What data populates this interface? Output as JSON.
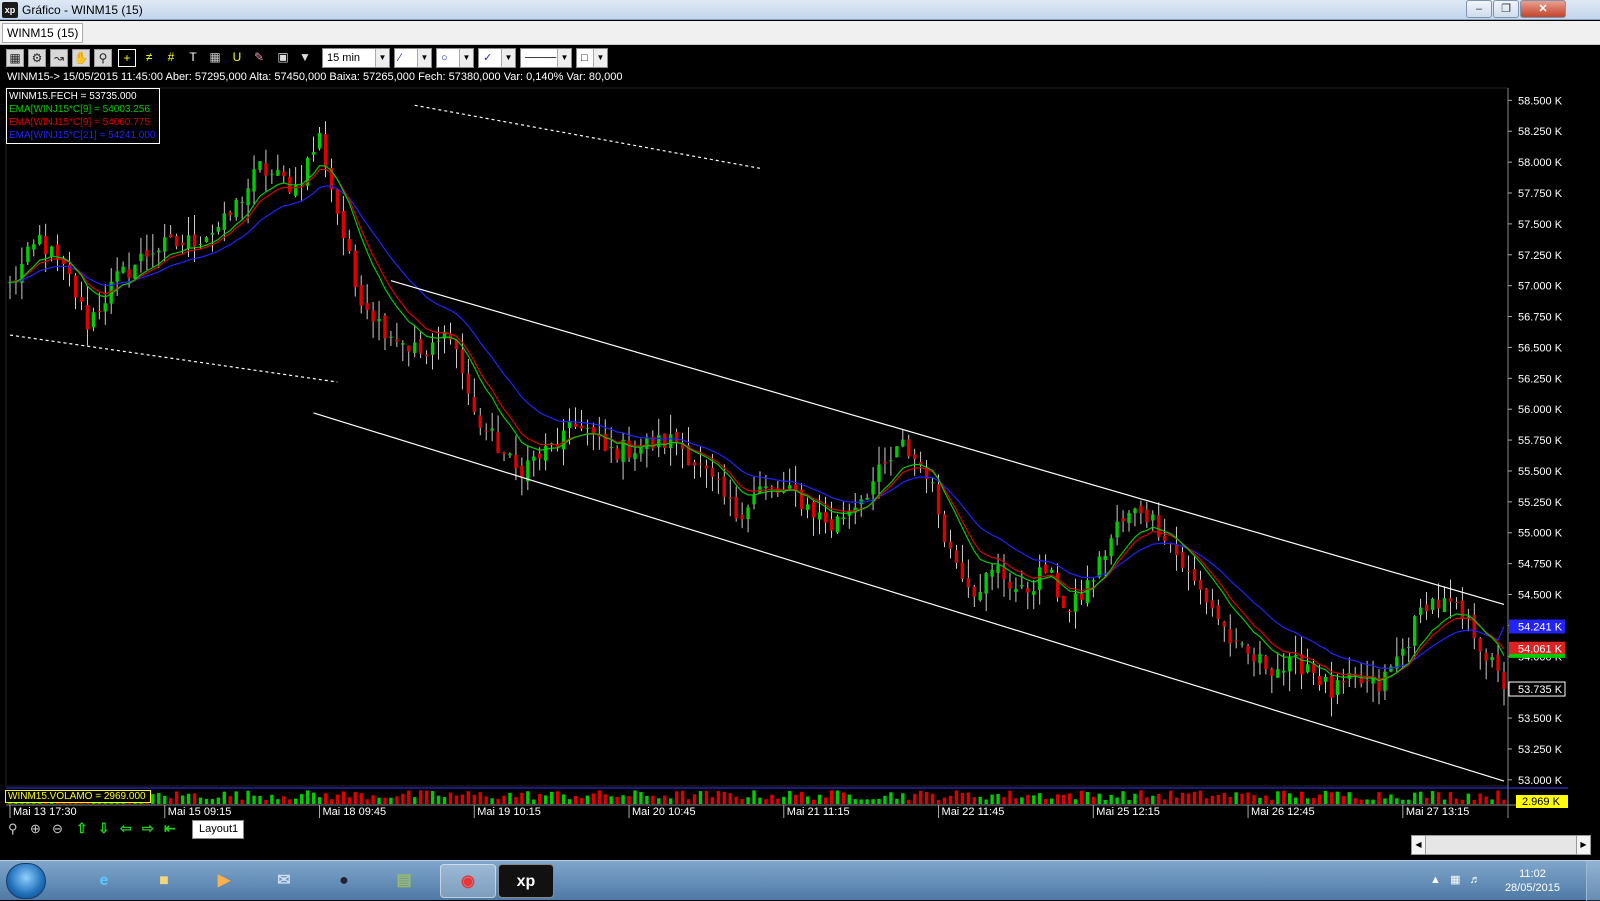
{
  "window": {
    "title": "Gráfico - WINM15 (15)",
    "app_icon": "xp",
    "buttons": [
      "minimize-icon",
      "maximize-icon",
      "close-icon"
    ]
  },
  "tab": {
    "label": "WINM15 (15)"
  },
  "toolbar": {
    "icons": [
      "chart-icon",
      "gear-icon",
      "indicator-icon",
      "hand-icon",
      "zoom-area-icon",
      "crosshair-icon",
      "fibonacci-icon",
      "grid-icon",
      "text-icon",
      "calculator-icon",
      "magnet-icon",
      "eraser-icon",
      "lock-icon",
      "filter-icon"
    ],
    "period": "15 min",
    "line_tool": "line-icon",
    "shape_tool": "circle-icon",
    "pen_tool": "pen-icon",
    "line_style": "solid-line-icon",
    "color_tool": "color-box-icon"
  },
  "info_line": "WINM15-> 15/05/2015 11:45:00 Aber: 57295,000 Alta: 57450,000 Baixa: 57265,000 Fech: 57380,000 Var: 0,140% Var: 80,000",
  "legend": {
    "items": [
      {
        "text": "WINM15.FECH = 53735.000",
        "color": "#ffffff"
      },
      {
        "text": "EMA[WINJ15*C[9] = 54003.256",
        "color": "#00cc00"
      },
      {
        "text": "EMA[WINJ15*C[9] = 54060.775",
        "color": "#dd0000"
      },
      {
        "text": "EMA[WINJ15*C[21] = 54241.000",
        "color": "#2222ff"
      }
    ]
  },
  "volume_legend": "WINM15.VOLAMO = 2969.000",
  "chart_data": {
    "type": "candlestick",
    "instrument": "WINM15",
    "interval": "15 min",
    "y_range": [
      52950,
      58600
    ],
    "y_ticks": [
      "58.500 K",
      "58.250 K",
      "58.000 K",
      "57.750 K",
      "57.500 K",
      "57.250 K",
      "57.000 K",
      "56.750 K",
      "56.500 K",
      "56.250 K",
      "56.000 K",
      "55.750 K",
      "55.500 K",
      "55.250 K",
      "55.000 K",
      "54.750 K",
      "54.500 K",
      "54.250 K",
      "54.000 K",
      "53.750 K",
      "53.500 K",
      "53.250 K",
      "53.000 K"
    ],
    "y_tick_values": [
      58500,
      58250,
      58000,
      57750,
      57500,
      57250,
      57000,
      56750,
      56500,
      56250,
      56000,
      55750,
      55500,
      55250,
      55000,
      54750,
      54500,
      54250,
      54000,
      53750,
      53500,
      53250,
      53000
    ],
    "x_labels": [
      "Mai 13 17:30",
      "Mai 15 09:15",
      "Mai 18 09:45",
      "Mai 19 10:15",
      "Mai 20 10:45",
      "Mai 21 11:15",
      "Mai 22 11:45",
      "Mai 25 12:15",
      "Mai 26 12:45",
      "Mai 27 13:15"
    ],
    "x_label_bars": [
      0,
      26,
      52,
      78,
      104,
      130,
      156,
      182,
      208,
      234
    ],
    "bar_count": 252,
    "close_path": [
      [
        0,
        57000
      ],
      [
        5,
        57380
      ],
      [
        10,
        57050
      ],
      [
        13,
        56700
      ],
      [
        18,
        57050
      ],
      [
        24,
        57300
      ],
      [
        30,
        57350
      ],
      [
        36,
        57500
      ],
      [
        42,
        57950
      ],
      [
        48,
        57800
      ],
      [
        52,
        58200
      ],
      [
        55,
        57600
      ],
      [
        58,
        57000
      ],
      [
        62,
        56700
      ],
      [
        66,
        56550
      ],
      [
        70,
        56420
      ],
      [
        74,
        56650
      ],
      [
        78,
        55950
      ],
      [
        82,
        55700
      ],
      [
        85,
        55500
      ],
      [
        90,
        55650
      ],
      [
        96,
        55900
      ],
      [
        100,
        55650
      ],
      [
        106,
        55700
      ],
      [
        112,
        55750
      ],
      [
        118,
        55400
      ],
      [
        122,
        55150
      ],
      [
        126,
        55350
      ],
      [
        132,
        55300
      ],
      [
        138,
        55050
      ],
      [
        144,
        55350
      ],
      [
        150,
        55700
      ],
      [
        154,
        55500
      ],
      [
        158,
        54850
      ],
      [
        162,
        54550
      ],
      [
        166,
        54700
      ],
      [
        170,
        54500
      ],
      [
        174,
        54700
      ],
      [
        178,
        54350
      ],
      [
        182,
        54650
      ],
      [
        186,
        55050
      ],
      [
        190,
        55200
      ],
      [
        194,
        55000
      ],
      [
        198,
        54650
      ],
      [
        202,
        54400
      ],
      [
        206,
        54050
      ],
      [
        210,
        53950
      ],
      [
        214,
        53900
      ],
      [
        218,
        53950
      ],
      [
        222,
        53700
      ],
      [
        226,
        53800
      ],
      [
        230,
        53750
      ],
      [
        234,
        54050
      ],
      [
        238,
        54450
      ],
      [
        242,
        54400
      ],
      [
        246,
        54200
      ],
      [
        251,
        53735
      ]
    ],
    "ema9_last": 54003.256,
    "ema9b_last": 54060.775,
    "ema21_last": 54241.0,
    "last_close": 53735,
    "last_volume": 2969,
    "price_tags": [
      {
        "text": "54.241 K",
        "value": 54241,
        "color": "#2222ff"
      },
      {
        "text": "54.061 K",
        "value": 54061,
        "color": "#dd2222"
      },
      {
        "text": "53.735 K",
        "value": 53735,
        "color": "#000000"
      }
    ],
    "volume_tag": "2.969 K",
    "trendlines": [
      {
        "from": [
          0,
          56600
        ],
        "to": [
          55,
          56220
        ],
        "style": "dotted"
      },
      {
        "from": [
          68,
          58460
        ],
        "to": [
          126,
          57950
        ],
        "style": "dotted"
      },
      {
        "from": [
          64,
          57040
        ],
        "to": [
          251,
          54420
        ],
        "style": "solid"
      },
      {
        "from": [
          51,
          55970
        ],
        "to": [
          251,
          52990
        ],
        "style": "solid"
      }
    ],
    "colors": {
      "up": "#00cc00",
      "down": "#dd0000",
      "wick": "#ffffff",
      "ema9": "#00cc00",
      "ema9b": "#dd0000",
      "ema21": "#2222ff",
      "channel": "#ffffff"
    }
  },
  "bottom_tools": [
    "zoom-icon",
    "zoom-in-icon",
    "zoom-out-icon",
    "arrow-up-icon",
    "arrow-down-icon",
    "arrow-left-icon",
    "arrow-right-icon",
    "scroll-end-icon"
  ],
  "layout_tab": "Layout1",
  "taskbar": {
    "apps": [
      "internet-explorer-icon",
      "folder-icon",
      "media-player-icon",
      "mail-icon",
      "hp-icon",
      "files-icon",
      "chrome-icon",
      "xp-icon"
    ],
    "active_app_label": "xp",
    "time": "11:02",
    "date": "28/05/2015"
  }
}
